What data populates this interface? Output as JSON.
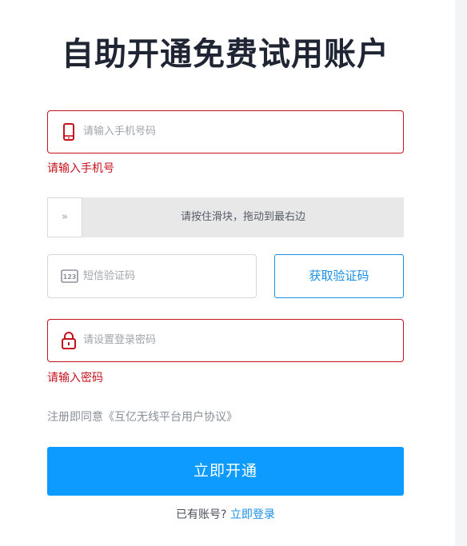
{
  "page": {
    "title": "自助开通免费试用账户"
  },
  "form": {
    "phone": {
      "placeholder": "请输入手机号码",
      "icon": "mobile-phone-icon",
      "error": "请输入手机号"
    },
    "slider": {
      "handle_glyph": "»",
      "text": "请按住滑块，拖动到最右边"
    },
    "sms": {
      "placeholder": "短信验证码",
      "icon": "sms-code-icon",
      "get_code_label": "获取验证码"
    },
    "password": {
      "placeholder": "请设置登录密码",
      "icon": "lock-icon",
      "error": "请输入密码"
    },
    "agreement": "注册即同意《互亿无线平台用户协议》",
    "submit_label": "立即开通",
    "login_prompt": "已有账号?",
    "login_link": "立即登录"
  },
  "colors": {
    "error": "#c6121d",
    "accent": "#1a8fe6",
    "primary_button": "#0e9bff"
  }
}
